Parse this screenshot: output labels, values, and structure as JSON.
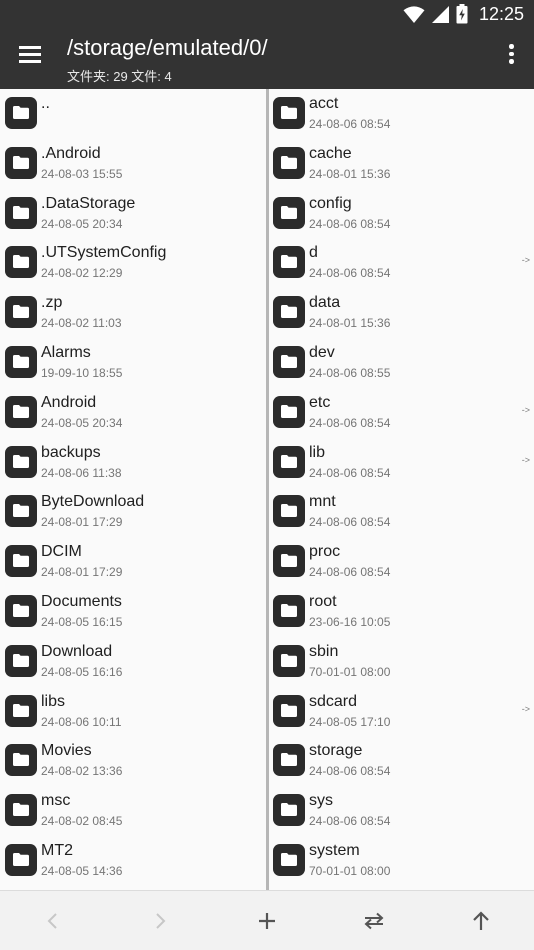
{
  "status_bar": {
    "time": "12:25",
    "icons": [
      "wifi-icon",
      "signal-icon",
      "battery-charging-icon"
    ]
  },
  "toolbar": {
    "path": "/storage/emulated/0/",
    "summary": "文件夹: 29  文件: 4",
    "menu_icon": "menu-icon",
    "more_icon": "more-vert-icon"
  },
  "left_pane": {
    "items": [
      {
        "name": "..",
        "date": ""
      },
      {
        "name": ".Android",
        "date": "24-08-03 15:55"
      },
      {
        "name": ".DataStorage",
        "date": "24-08-05 20:34"
      },
      {
        "name": ".UTSystemConfig",
        "date": "24-08-02 12:29"
      },
      {
        "name": ".zp",
        "date": "24-08-02 11:03"
      },
      {
        "name": "Alarms",
        "date": "19-09-10 18:55"
      },
      {
        "name": "Android",
        "date": "24-08-05 20:34"
      },
      {
        "name": "backups",
        "date": "24-08-06 11:38"
      },
      {
        "name": "ByteDownload",
        "date": "24-08-01 17:29"
      },
      {
        "name": "DCIM",
        "date": "24-08-01 17:29"
      },
      {
        "name": "Documents",
        "date": "24-08-05 16:15"
      },
      {
        "name": "Download",
        "date": "24-08-05 16:16"
      },
      {
        "name": "libs",
        "date": "24-08-06 10:11"
      },
      {
        "name": "Movies",
        "date": "24-08-02 13:36"
      },
      {
        "name": "msc",
        "date": "24-08-02 08:45"
      },
      {
        "name": "MT2",
        "date": "24-08-05 14:36"
      }
    ]
  },
  "right_pane": {
    "items": [
      {
        "name": "acct",
        "date": "24-08-06 08:54",
        "link": ""
      },
      {
        "name": "cache",
        "date": "24-08-01 15:36",
        "link": ""
      },
      {
        "name": "config",
        "date": "24-08-06 08:54",
        "link": ""
      },
      {
        "name": "d",
        "date": "24-08-06 08:54",
        "link": "->"
      },
      {
        "name": "data",
        "date": "24-08-01 15:36",
        "link": ""
      },
      {
        "name": "dev",
        "date": "24-08-06 08:55",
        "link": ""
      },
      {
        "name": "etc",
        "date": "24-08-06 08:54",
        "link": "->"
      },
      {
        "name": "lib",
        "date": "24-08-06 08:54",
        "link": "->"
      },
      {
        "name": "mnt",
        "date": "24-08-06 08:54",
        "link": ""
      },
      {
        "name": "proc",
        "date": "24-08-06 08:54",
        "link": ""
      },
      {
        "name": "root",
        "date": "23-06-16 10:05",
        "link": ""
      },
      {
        "name": "sbin",
        "date": "70-01-01 08:00",
        "link": ""
      },
      {
        "name": "sdcard",
        "date": "24-08-05 17:10",
        "link": "->"
      },
      {
        "name": "storage",
        "date": "24-08-06 08:54",
        "link": ""
      },
      {
        "name": "sys",
        "date": "24-08-06 08:54",
        "link": ""
      },
      {
        "name": "system",
        "date": "70-01-01 08:00",
        "link": ""
      }
    ]
  },
  "bottom_bar": {
    "buttons": [
      {
        "icon": "back-chevron-icon",
        "enabled": false
      },
      {
        "icon": "forward-chevron-icon",
        "enabled": false
      },
      {
        "icon": "add-icon",
        "enabled": true
      },
      {
        "icon": "swap-icon",
        "enabled": true
      },
      {
        "icon": "up-arrow-icon",
        "enabled": true
      }
    ]
  },
  "colors": {
    "appbar": "#333333",
    "folder_tile": "#2b2b2b",
    "pane_bg": "#fafafa",
    "divider": "#b6b6b6"
  }
}
